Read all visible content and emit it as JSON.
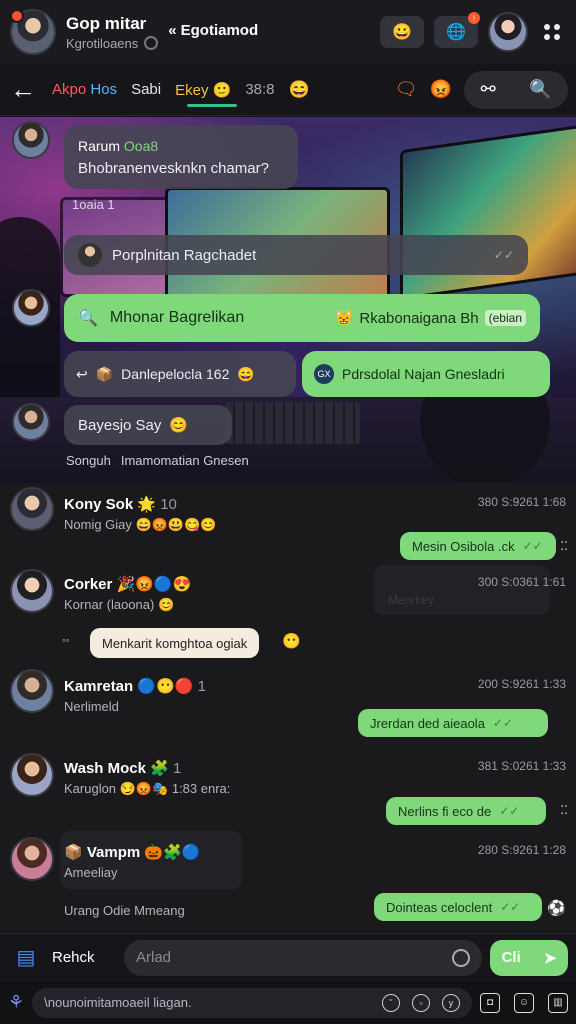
{
  "header": {
    "title": "Gop mitar",
    "subtitle": "Kgrotiloaens",
    "group_name": "Egotiamod",
    "group_prefix": "«"
  },
  "tabs": [
    {
      "label": "Akpo",
      "label2": "Hos"
    },
    {
      "label": "Sabi"
    },
    {
      "label": "Ekey"
    },
    {
      "label": "38:8"
    }
  ],
  "hero": {
    "msg1_name": "Rarum",
    "msg1_name_tag": "Ooa8",
    "msg1_text": "Bhobranenvesknkn chamar?",
    "msg1_time": "1oaia 1",
    "msg2_text": "Porplnitan Ragchadet",
    "msg3_left": "Mhonar Bagrelikan",
    "msg3_right": "Rkabonaigana Bh",
    "msg3_tag": "(ebian",
    "msg4_text": "Danlepelocla 162",
    "msg5_text": "Pdrsdolal Najan Gnesladri",
    "msg6_text": "Bayesjo Say",
    "footer_a": "Songuh",
    "footer_b": "Imamomatian Gnesen"
  },
  "chats": [
    {
      "name": "Kony Sok",
      "extra": "10",
      "preview": "Nomig Giay",
      "time": "380 S:9261 1:68",
      "out": "Mesin Osibola .ck"
    },
    {
      "name": "Corker",
      "preview": "Kornar (laoona)",
      "time": "300 S:0361 1:61",
      "ghost": "Menrkey",
      "pill": "Menkarit komghtoa ogiak"
    },
    {
      "name": "Kamretan",
      "extra": "1",
      "preview": "Nerlimeld",
      "time": "200 S:9261 1:33",
      "out": "Jrerdan ded aieaola"
    },
    {
      "name": "Wash Mock",
      "extra": "1",
      "preview": "Karuglon",
      "preview_tail": "1:83 enra:",
      "time": "381 S:0261 1:33",
      "out": "Nerlins fi eco de"
    },
    {
      "name": "Vampm",
      "preview": "Ameeliay",
      "preview2": "Urang Odie Mmeang",
      "time": "280 S:9261 1:28",
      "out": "Dointeas celoclent"
    }
  ],
  "composer": {
    "label": "Rehck",
    "placeholder": "Arlad",
    "send_label": "Cli"
  },
  "bottom": {
    "placeholder": "\\nounoimitamoaeil liagan."
  },
  "colors": {
    "accent_green": "#7fd97a",
    "accent_red": "#ff5b5b",
    "accent_blue": "#56b4ff",
    "background": "#141416"
  }
}
